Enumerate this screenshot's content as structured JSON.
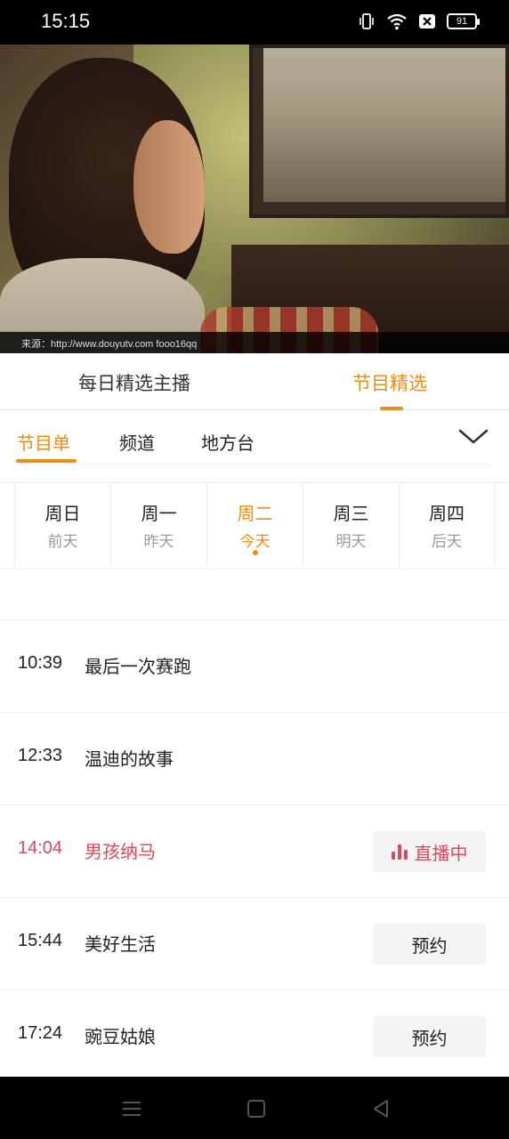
{
  "status_bar": {
    "time": "15:15",
    "battery": "91",
    "icons": [
      "vibrate-icon",
      "wifi-icon",
      "no-sim-icon",
      "battery-icon"
    ]
  },
  "video": {
    "caption": "来源：http://www.douyutv.com fooo16qq"
  },
  "main_tabs": [
    {
      "label": "每日精选主播",
      "active": false
    },
    {
      "label": "节目精选",
      "active": true
    }
  ],
  "sub_tabs": [
    {
      "label": "节目单",
      "active": true
    },
    {
      "label": "频道",
      "active": false
    },
    {
      "label": "地方台",
      "active": false
    }
  ],
  "expand_icon": "chevron-down-icon",
  "days": [
    {
      "weekday": "周日",
      "relative": "前天",
      "active": false
    },
    {
      "weekday": "周一",
      "relative": "昨天",
      "active": false
    },
    {
      "weekday": "周二",
      "relative": "今天",
      "active": true
    },
    {
      "weekday": "周三",
      "relative": "明天",
      "active": false
    },
    {
      "weekday": "周四",
      "relative": "后天",
      "active": false
    }
  ],
  "schedule": [
    {
      "time": "10:39",
      "title": "最后一次赛跑",
      "status": "none",
      "action": ""
    },
    {
      "time": "12:33",
      "title": "温迪的故事",
      "status": "none",
      "action": ""
    },
    {
      "time": "14:04",
      "title": "男孩纳马",
      "status": "live",
      "action": "直播中"
    },
    {
      "time": "15:44",
      "title": "美好生活",
      "status": "reserve",
      "action": "预约"
    },
    {
      "time": "17:24",
      "title": "豌豆姑娘",
      "status": "reserve",
      "action": "预约"
    }
  ],
  "colors": {
    "accent": "#f08c14",
    "live": "#e0475a",
    "button_bg": "#f4f4f4"
  },
  "nav_bar": {
    "icons": [
      "menu-icon",
      "home-icon",
      "back-icon"
    ]
  }
}
